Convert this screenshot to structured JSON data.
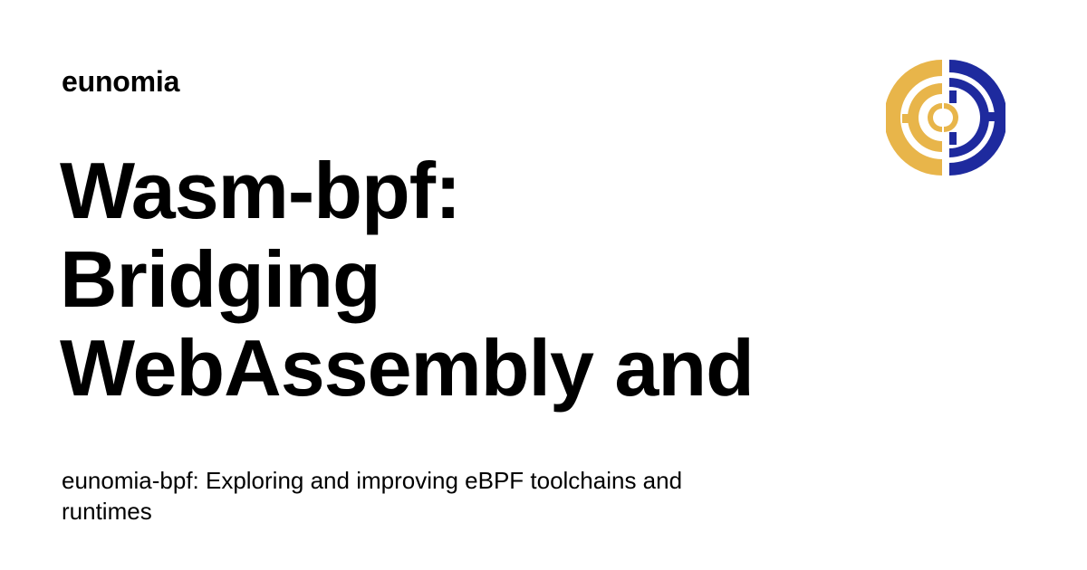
{
  "site": {
    "name": "eunomia"
  },
  "article": {
    "title_lines": [
      "Wasm-bpf:",
      "Bridging",
      "WebAssembly and"
    ],
    "description": "eunomia-bpf: Exploring and improving eBPF toolchains and runtimes"
  },
  "logo": {
    "icon": "eunomia-logo-icon",
    "colors": {
      "left": "#E8B54A",
      "right": "#1E2A9E"
    }
  }
}
